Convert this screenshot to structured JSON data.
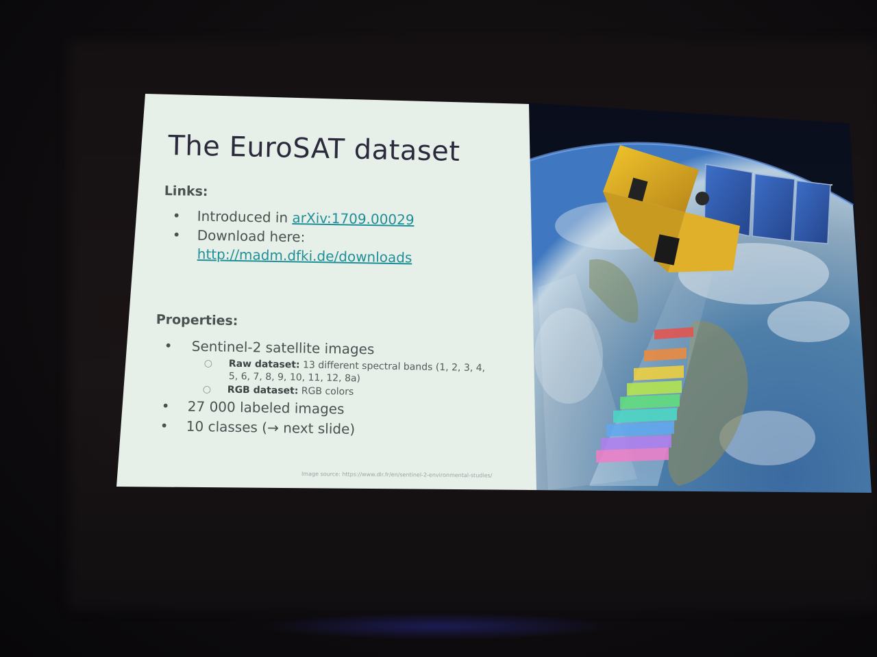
{
  "slide": {
    "title": "The EuroSAT dataset",
    "links_heading": "Links:",
    "links": [
      {
        "prefix": "Introduced in ",
        "link": "arXiv:1709.00029"
      },
      {
        "prefix": "Download here:",
        "link": "http://madm.dfki.de/downloads"
      }
    ],
    "properties_heading": "Properties:",
    "properties": [
      {
        "text": "Sentinel-2 satellite images",
        "sub": [
          {
            "bold": "Raw dataset:",
            "text": " 13 different spectral bands (1, 2, 3, 4,",
            "cont": "5, 6, 7, 8, 9, 10, 11, 12, 8a)"
          },
          {
            "bold": "RGB dataset:",
            "text": " RGB colors"
          }
        ]
      },
      {
        "text": "27 000 labeled images"
      },
      {
        "text": "10 classes (→ next slide)"
      }
    ],
    "image_credit": "Image source: https://www.dlr.fr/en/sentinel-2-environmental-studies/"
  },
  "icons": {
    "bullet": "bullet-dot-icon",
    "sub_bullet": "hollow-circle-icon",
    "satellite": "satellite-icon"
  },
  "colors": {
    "slide_background": "#e7efe9",
    "link": "#1f8f97",
    "title": "#2a2a3c",
    "room": "#0b0a0e"
  }
}
